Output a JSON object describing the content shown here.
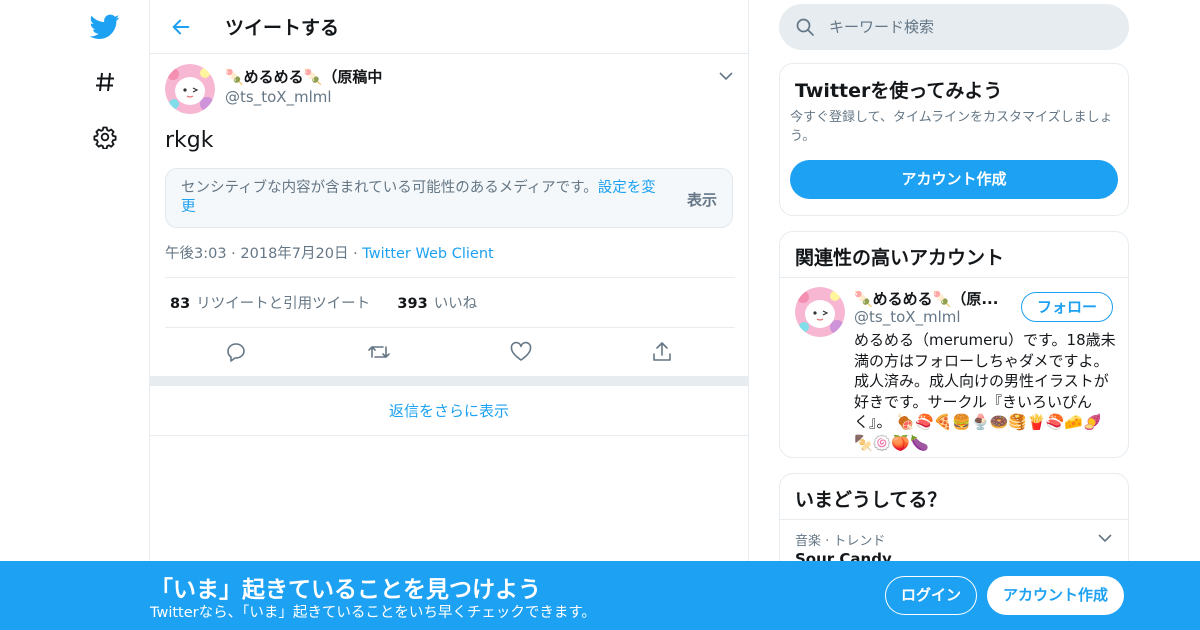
{
  "colors": {
    "accent": "#1da1f2",
    "muted": "#657786",
    "border": "#e6ecf0",
    "text": "#14171a"
  },
  "nav": {
    "icons": [
      "twitter-bird-icon",
      "hashtag-icon",
      "gear-icon"
    ]
  },
  "header": {
    "title": "ツイートする"
  },
  "tweet": {
    "author_name": "🍡めるめる🍡（原稿中",
    "author_handle": "@ts_toX_mlml",
    "text": "rkgk",
    "sensitive_text": "センシティブな内容が含まれている可能性のあるメディアです。",
    "sensitive_link": "設定を変更",
    "sensitive_show": "表示",
    "time": "午後3:03",
    "date": "2018年7月20日",
    "client": "Twitter Web Client",
    "retweet_count": "83",
    "retweet_label": "リツイートと引用ツイート",
    "like_count": "393",
    "like_label": "いいね",
    "more_replies": "返信をさらに表示"
  },
  "search": {
    "placeholder": "キーワード検索"
  },
  "signup_card": {
    "title": "Twitterを使ってみよう",
    "subtitle": "今すぐ登録して、タイムラインをカスタマイズしましょう。",
    "button": "アカウント作成"
  },
  "related": {
    "title": "関連性の高いアカウント",
    "name": "🍡めるめる🍡（原...",
    "handle": "@ts_toX_mlml",
    "follow": "フォロー",
    "bio": "めるめる（merumeru）です。18歳未満の方はフォローしちゃダメですよ。成人済み。成人向けの男性イラストが好きです。サークル『きいろいぴんく』。",
    "emojis": "🍖🍣🍕🍔🍨🍩🥞🍟🍣🧀🍠🍢🍥🍑🍆"
  },
  "trends": {
    "title": "いまどうしてる？",
    "category": "音楽 · トレンド",
    "name": "Sour Candy"
  },
  "banner": {
    "title": "「いま」起きていることを見つけよう",
    "subtitle": "Twitterなら、「いま」起きていることをいち早くチェックできます。",
    "login": "ログイン",
    "signup": "アカウント作成"
  }
}
